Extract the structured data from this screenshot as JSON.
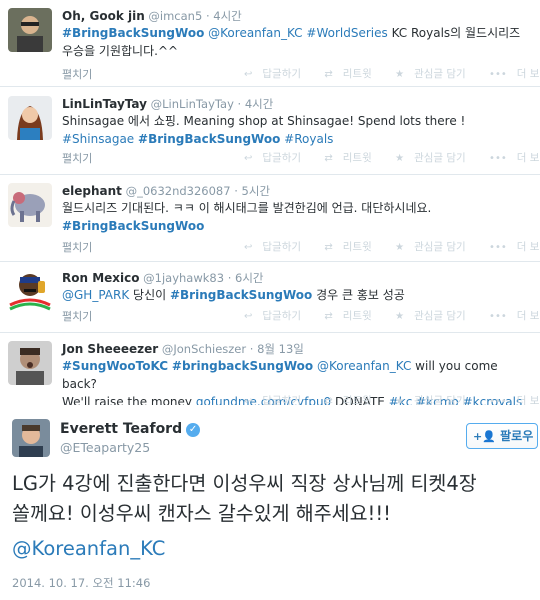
{
  "timeline": [
    {
      "name": "Oh, Gook jin",
      "handle": "@imcan5",
      "time": "4시간",
      "line1": [
        {
          "t": "#BringBackSungWoo",
          "k": "tag"
        },
        {
          "t": " ",
          "k": "plain"
        },
        {
          "t": "@Koreanfan_KC",
          "k": "mention"
        },
        {
          "t": " ",
          "k": "plain"
        },
        {
          "t": "#WorldSeries",
          "k": "tag"
        },
        {
          "t": " KC Royals의 월드시리즈",
          "k": "plain"
        }
      ],
      "line2": [
        {
          "t": "우승을 기원합니다.^^",
          "k": "plain"
        }
      ],
      "expand": "펼치기",
      "actions": {
        "reply": "답글하기",
        "retweet": "리트윗",
        "favorite": "관심글 담기",
        "more": "더 보기"
      }
    },
    {
      "name": "LinLinTayTay",
      "handle": "@LinLinTayTay",
      "time": "4시간",
      "line1": [
        {
          "t": "Shinsagae 에서 쇼핑.      Meaning shop at Shinsagae!   Spend lots there !",
          "k": "plain"
        }
      ],
      "line2": [
        {
          "t": "#Shinsagae",
          "k": "tag"
        },
        {
          "t": " ",
          "k": "plain"
        },
        {
          "t": "#BringBackSungWoo",
          "k": "tag"
        },
        {
          "t": " ",
          "k": "plain"
        },
        {
          "t": "#Royals",
          "k": "tag"
        }
      ],
      "expand": "펼치기",
      "actions": {
        "reply": "답글하기",
        "retweet": "리트윗",
        "favorite": "관심글 담기",
        "more": "더 보기"
      }
    },
    {
      "name": "elephant",
      "handle": "@_0632nd326087",
      "time": "5시간",
      "line1": [
        {
          "t": "월드시리즈 기대된다. ㅋㅋ 이 해시태그를 발견한김에 언급. 대단하시네요.",
          "k": "plain"
        }
      ],
      "line2": [
        {
          "t": "#BringBackSungWoo",
          "k": "tag"
        }
      ],
      "expand": "펼치기",
      "actions": {
        "reply": "답글하기",
        "retweet": "리트윗",
        "favorite": "관심글 담기",
        "more": "더 보기"
      }
    },
    {
      "name": "Ron Mexico",
      "handle": "@1jayhawk83",
      "time": "6시간",
      "line1": [
        {
          "t": "@GH_PARK",
          "k": "mention"
        },
        {
          "t": " 당신이 ",
          "k": "plain"
        },
        {
          "t": "#BringBackSungWoo",
          "k": "tag"
        },
        {
          "t": " 경우 큰 홍보 성공",
          "k": "plain"
        }
      ],
      "line2": [],
      "expand": "펼치기",
      "actions": {
        "reply": "답글하기",
        "retweet": "리트윗",
        "favorite": "관심글 담기",
        "more": "더 보기"
      }
    },
    {
      "name": "Jon Sheeeezer",
      "handle": "@JonSchieszer",
      "time": "8월 13일",
      "line1": [
        {
          "t": "#SungWooToKC",
          "k": "tag"
        },
        {
          "t": " ",
          "k": "plain"
        },
        {
          "t": "#bringbackSungWoo",
          "k": "tag"
        },
        {
          "t": " ",
          "k": "plain"
        },
        {
          "t": "@Koreanfan_KC",
          "k": "mention"
        },
        {
          "t": " will you come back?",
          "k": "plain"
        }
      ],
      "line2": [
        {
          "t": "We'll raise the money ",
          "k": "plain"
        },
        {
          "t": "gofundme.com/cyfpu0",
          "k": "mention"
        },
        {
          "t": " DONATE ",
          "k": "plain"
        },
        {
          "t": "#kc",
          "k": "tag"
        },
        {
          "t": " ",
          "k": "plain"
        },
        {
          "t": "#kcmo",
          "k": "tag"
        },
        {
          "t": " ",
          "k": "plain"
        },
        {
          "t": "#kcroyals",
          "k": "tag"
        }
      ],
      "expand": "",
      "actions": {
        "reply": "답글하기",
        "retweet": "리트윗",
        "favorite": "관심글 담기",
        "more": "더 보기"
      }
    }
  ],
  "expanded": {
    "name": "Everett Teaford",
    "handle": "@ETeaparty25",
    "follow_label": "팔로우",
    "text_line1": "LG가 4강에 진출한다면 이성우씨 직장 상사님께 티켓4장",
    "text_line2": "쏠께요! 이성우씨 캔자스 갈수있게 해주세요!!!",
    "mention": "@Koreanfan_KC",
    "timestamp": "2014. 10. 17. 오전 11:46"
  },
  "colors": {
    "link": "#2b7bb9",
    "muted": "#8899a6",
    "verified": "#55acee"
  }
}
